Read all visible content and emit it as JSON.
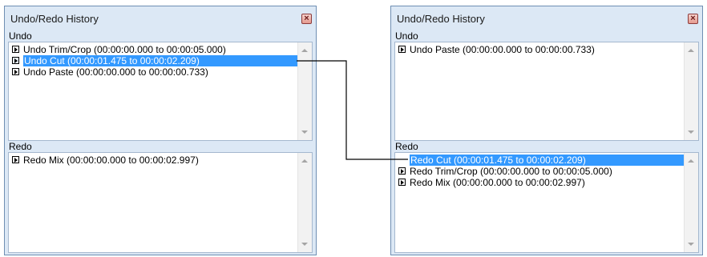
{
  "panels": [
    {
      "title": "Undo/Redo History",
      "close_glyph": "×",
      "undo_label": "Undo",
      "redo_label": "Redo",
      "undo_items": [
        {
          "label": "Undo Trim/Crop (00:00:00.000 to 00:00:05.000)",
          "selected": false
        },
        {
          "label": "Undo Cut (00:00:01.475 to 00:00:02.209)",
          "selected": true
        },
        {
          "label": "Undo Paste (00:00:00.000 to 00:00:00.733)",
          "selected": false
        }
      ],
      "redo_items": [
        {
          "label": "Redo Mix (00:00:00.000 to 00:00:02.997)",
          "selected": false
        }
      ]
    },
    {
      "title": "Undo/Redo History",
      "close_glyph": "×",
      "undo_label": "Undo",
      "redo_label": "Redo",
      "undo_items": [
        {
          "label": "Undo Paste (00:00:00.000 to 00:00:00.733)",
          "selected": false
        }
      ],
      "redo_items": [
        {
          "label": "Redo Cut (00:00:01.475 to 00:00:02.209)",
          "selected": true
        },
        {
          "label": "Redo Trim/Crop (00:00:00.000 to 00:00:05.000)",
          "selected": false
        },
        {
          "label": "Redo Mix (00:00:00.000 to 00:00:02.997)",
          "selected": false
        }
      ]
    }
  ],
  "colors": {
    "selection": "#3399ff",
    "panel_bg": "#dce8f5",
    "connector": "#000000"
  },
  "icons": {
    "item_marker": "expand-arrow-icon",
    "close": "close-icon"
  }
}
